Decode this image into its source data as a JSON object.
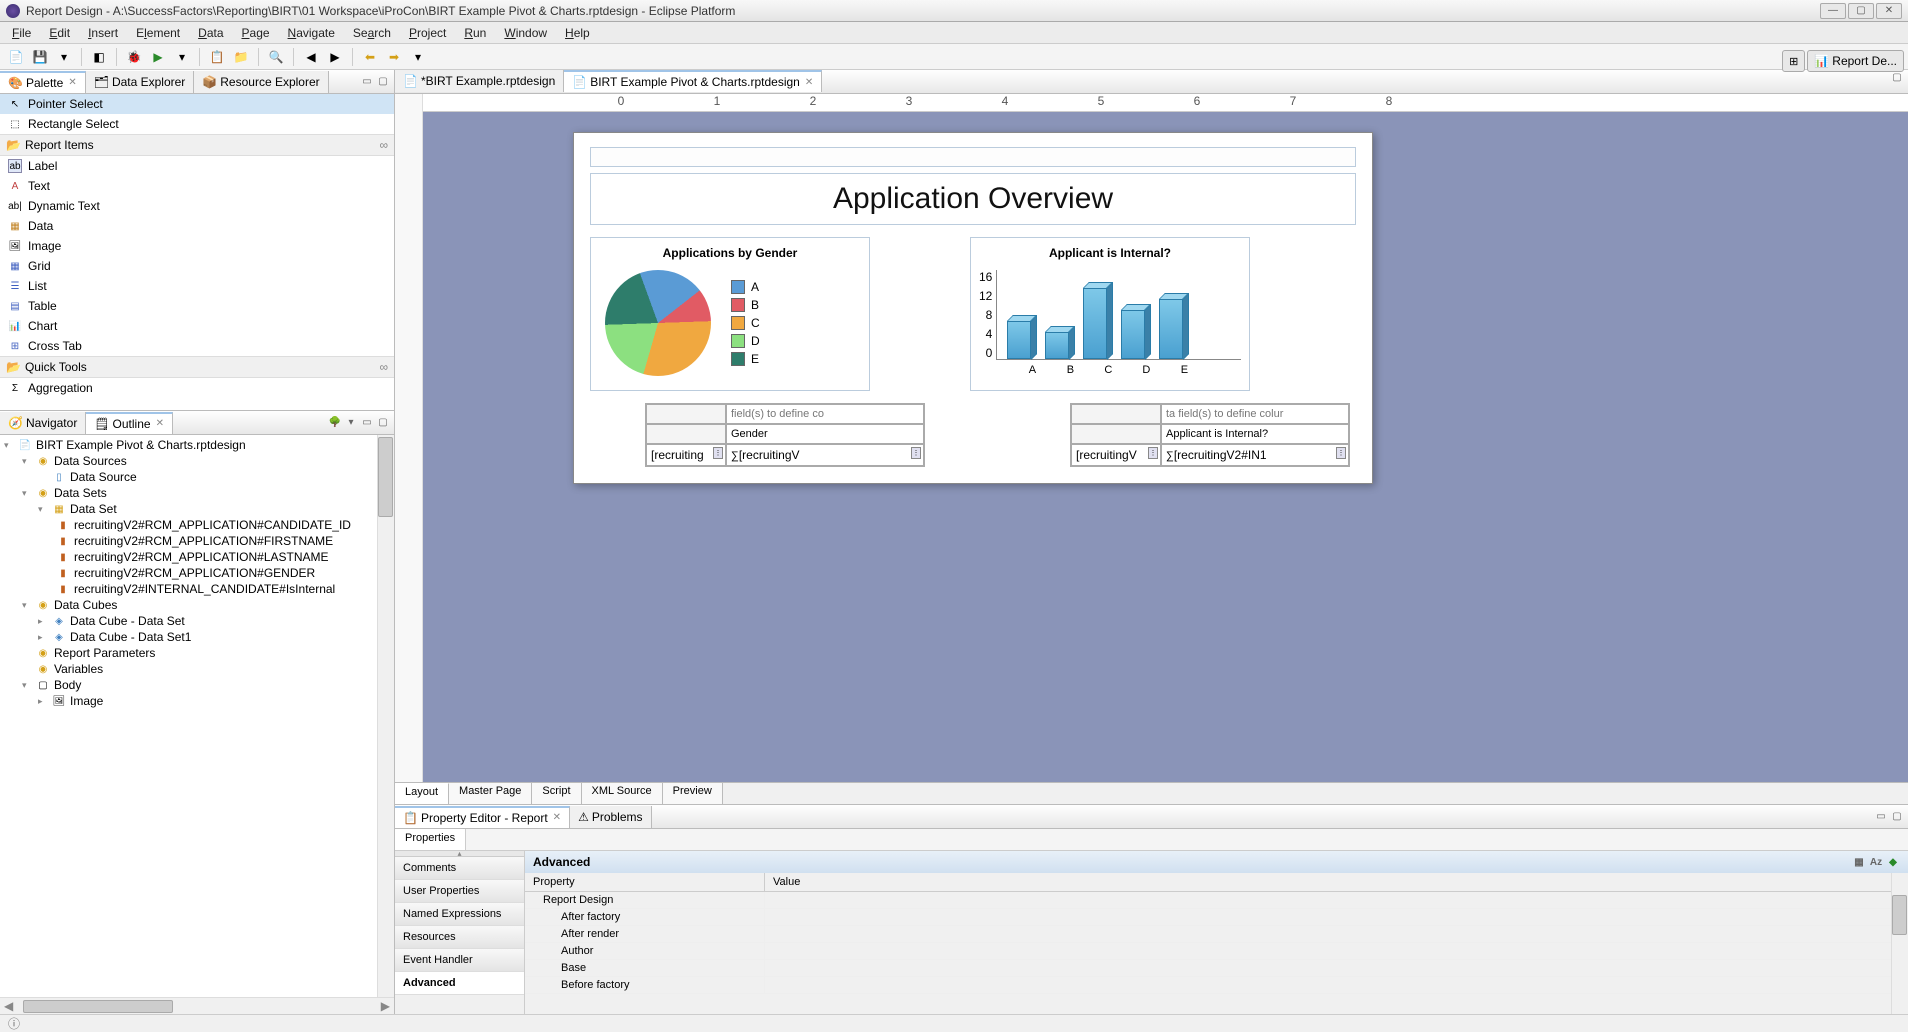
{
  "window": {
    "title": "Report Design - A:\\SuccessFactors\\Reporting\\BIRT\\01 Workspace\\iProCon\\BIRT Example Pivot & Charts.rptdesign - Eclipse Platform"
  },
  "menu": [
    "File",
    "Edit",
    "Insert",
    "Element",
    "Data",
    "Page",
    "Navigate",
    "Search",
    "Project",
    "Run",
    "Window",
    "Help"
  ],
  "perspective": {
    "label": "Report De..."
  },
  "left": {
    "top_tabs": [
      {
        "label": "Palette",
        "active": true
      },
      {
        "label": "Data Explorer",
        "active": false
      },
      {
        "label": "Resource Explorer",
        "active": false
      }
    ],
    "palette": {
      "select": [
        "Pointer Select",
        "Rectangle Select"
      ],
      "sections": [
        {
          "title": "Report Items",
          "items": [
            "Label",
            "Text",
            "Dynamic Text",
            "Data",
            "Image",
            "Grid",
            "List",
            "Table",
            "Chart",
            "Cross Tab"
          ]
        },
        {
          "title": "Quick Tools",
          "items": [
            "Aggregation"
          ]
        }
      ]
    },
    "bottom_tabs": [
      {
        "label": "Navigator",
        "active": false
      },
      {
        "label": "Outline",
        "active": true
      }
    ],
    "outline": {
      "root": "BIRT Example Pivot & Charts.rptdesign",
      "nodes": [
        {
          "label": "Data Sources",
          "children": [
            {
              "label": "Data Source"
            }
          ]
        },
        {
          "label": "Data Sets",
          "children": [
            {
              "label": "Data Set",
              "children": [
                {
                  "label": "recruitingV2#RCM_APPLICATION#CANDIDATE_ID"
                },
                {
                  "label": "recruitingV2#RCM_APPLICATION#FIRSTNAME"
                },
                {
                  "label": "recruitingV2#RCM_APPLICATION#LASTNAME"
                },
                {
                  "label": "recruitingV2#RCM_APPLICATION#GENDER"
                },
                {
                  "label": "recruitingV2#INTERNAL_CANDIDATE#IsInternal"
                }
              ]
            }
          ]
        },
        {
          "label": "Data Cubes",
          "children": [
            {
              "label": "Data Cube - Data Set"
            },
            {
              "label": "Data Cube - Data Set1"
            }
          ]
        },
        {
          "label": "Report Parameters"
        },
        {
          "label": "Variables"
        },
        {
          "label": "Body",
          "children": [
            {
              "label": "Image"
            }
          ]
        }
      ]
    }
  },
  "editor": {
    "tabs": [
      {
        "label": "*BIRT Example.rptdesign",
        "active": false
      },
      {
        "label": "BIRT Example Pivot & Charts.rptdesign",
        "active": true
      }
    ],
    "bottom_tabs": [
      "Layout",
      "Master Page",
      "Script",
      "XML Source",
      "Preview"
    ],
    "active_bottom": "Layout",
    "report": {
      "title": "Application Overview",
      "pie": {
        "title": "Applications by Gender"
      },
      "bar": {
        "title": "Applicant is Internal?"
      },
      "crosstab1": {
        "top_hint": "field(s) to define co",
        "col_header": "Gender",
        "row_field": "[recruiting",
        "measure": "[recruitingV"
      },
      "crosstab2": {
        "top_hint": "ta field(s) to define colur",
        "col_header": "Applicant is Internal?",
        "row_field": "[recruitingV",
        "measure": "[recruitingV2#IN1"
      }
    }
  },
  "chart_data": [
    {
      "type": "pie",
      "title": "Applications by Gender",
      "categories": [
        "A",
        "B",
        "C",
        "D",
        "E"
      ],
      "values": [
        20,
        10,
        30,
        20,
        20
      ],
      "colors": [
        "#5a9bd5",
        "#e15b64",
        "#f0a840",
        "#8ce080",
        "#2e7d6b"
      ]
    },
    {
      "type": "bar",
      "title": "Applicant is Internal?",
      "categories": [
        "A",
        "B",
        "C",
        "D",
        "E"
      ],
      "values": [
        7,
        5,
        13,
        9,
        11
      ],
      "ylabel": "",
      "ylim": [
        0,
        16
      ],
      "yticks": [
        0,
        4,
        8,
        12,
        16
      ]
    }
  ],
  "property_editor": {
    "tabs": [
      {
        "label": "Property Editor - Report",
        "active": true
      },
      {
        "label": "Problems",
        "active": false
      }
    ],
    "sub_tab": "Properties",
    "categories": [
      "Comments",
      "User Properties",
      "Named Expressions",
      "Resources",
      "Event Handler",
      "Advanced"
    ],
    "active_category": "Advanced",
    "section": "Advanced",
    "columns": [
      "Property",
      "Value"
    ],
    "rows": [
      {
        "prop": "Report Design",
        "val": ""
      },
      {
        "prop": "After factory",
        "val": ""
      },
      {
        "prop": "After render",
        "val": ""
      },
      {
        "prop": "Author",
        "val": ""
      },
      {
        "prop": "Base",
        "val": ""
      },
      {
        "prop": "Before factory",
        "val": ""
      }
    ]
  }
}
